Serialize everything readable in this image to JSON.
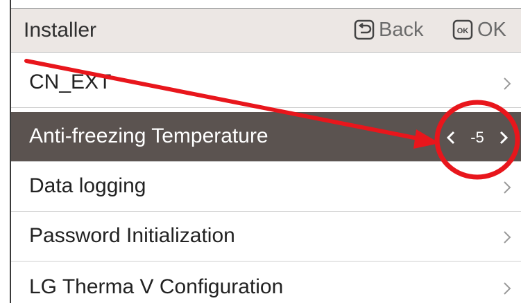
{
  "header": {
    "title": "Installer",
    "back_label": "Back",
    "ok_label": "OK",
    "back_icon": "back-icon",
    "ok_icon": "ok-icon"
  },
  "menu": {
    "items": [
      {
        "label": "CN_EXT"
      },
      {
        "label": "Anti-freezing Temperature",
        "value": "-5",
        "selected": true
      },
      {
        "label": "Data logging"
      },
      {
        "label": "Password Initialization"
      },
      {
        "label": "LG Therma V Configuration"
      }
    ]
  },
  "colors": {
    "selected_row": "#5b5350",
    "header_bg": "#ece7e4",
    "annotation": "#e8161c"
  }
}
